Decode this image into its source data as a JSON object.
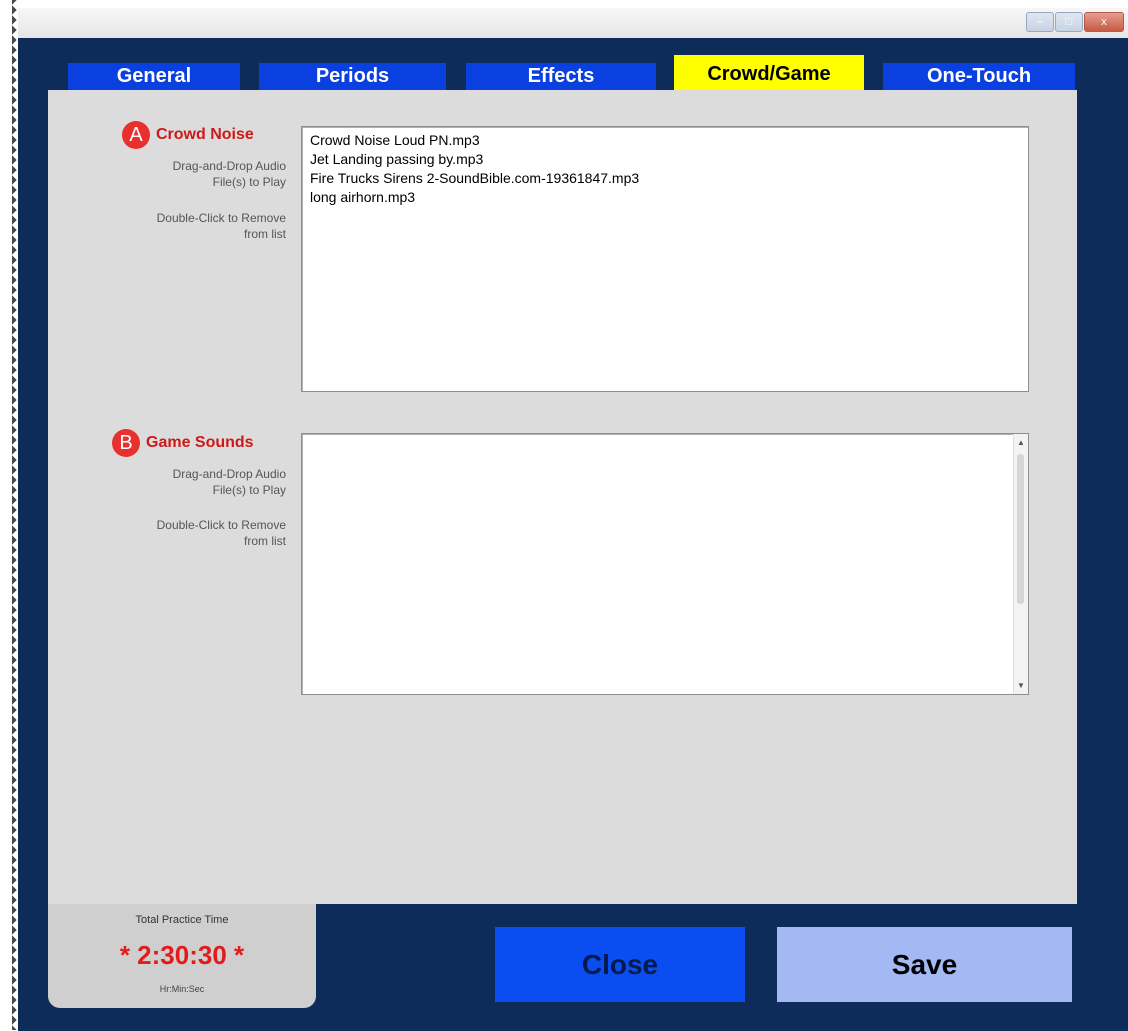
{
  "window": {
    "controls": {
      "minimize": "–",
      "maximize": "□",
      "close": "x"
    }
  },
  "tabs": [
    {
      "label": "General",
      "active": false
    },
    {
      "label": "Periods",
      "active": false
    },
    {
      "label": "Effects",
      "active": false
    },
    {
      "label": "Crowd/Game",
      "active": true
    },
    {
      "label": "One-Touch",
      "active": false
    }
  ],
  "crowd": {
    "badge": "A",
    "title": "Crowd Noise",
    "help1": "Drag-and-Drop Audio File(s) to Play",
    "help2": "Double-Click to Remove from list",
    "items": [
      "Crowd Noise Loud PN.mp3",
      "Jet Landing passing by.mp3",
      "Fire Trucks Sirens 2-SoundBible.com-19361847.mp3",
      "long airhorn.mp3"
    ]
  },
  "game": {
    "badge": "B",
    "title": "Game Sounds",
    "help1": "Drag-and-Drop Audio File(s) to Play",
    "help2": "Double-Click to Remove from list",
    "items": [],
    "scroll_up": "▲",
    "scroll_down": "▼"
  },
  "practice": {
    "label": "Total Practice Time",
    "time": "* 2:30:30 *",
    "units": "Hr:Min:Sec"
  },
  "buttons": {
    "close": "Close",
    "save": "Save"
  },
  "colors": {
    "frame": "#0d2c5a",
    "tab": "#0a3fe0",
    "tab_active": "#ffff00",
    "panel": "#dcdcdc",
    "accent_red": "#e8302f",
    "close_button": "#0a4ef2",
    "save_button": "#a4b8f4"
  }
}
